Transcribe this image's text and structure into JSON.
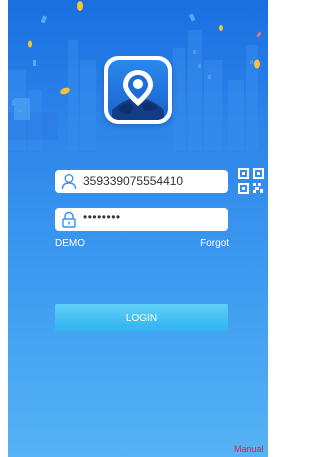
{
  "login": {
    "username_value": "359339075554410",
    "password_value": "••••••••",
    "demo_label": "DEMO",
    "forgot_label": "Forgot",
    "login_label": "LOGIN"
  },
  "footer": {
    "manual_label": "Manual"
  },
  "icons": {
    "app_logo": "map-pin-globe-icon",
    "user": "user-icon",
    "lock": "lock-icon",
    "qr": "qr-code-icon"
  },
  "colors": {
    "background_top": "#1a6fe0",
    "background_bottom": "#56b3f5",
    "button": "#2fb2ee",
    "manual_link": "#e3203a"
  }
}
